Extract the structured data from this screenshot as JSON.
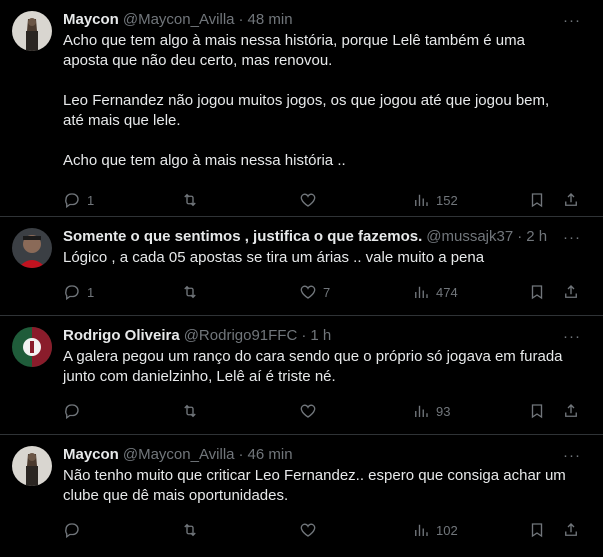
{
  "tweets": [
    {
      "name": "Maycon",
      "handle": "@Maycon_Avilla",
      "time": "48 min",
      "text": "Acho que tem algo à mais nessa história, porque Lelê também é uma\naposta que não deu certo, mas renovou.\n\nLeo Fernandez não jogou muitos jogos, os que jogou até que jogou bem,\naté mais que lele.\n\nAcho que tem algo à mais nessa história ..",
      "replies": "1",
      "retweets": "",
      "likes": "",
      "views": "152"
    },
    {
      "name": "Somente o que sentimos , justifica o que fazemos.",
      "handle": "@mussajk37",
      "time": "2 h",
      "text": "Lógico , a cada 05 apostas se tira um árias .. vale muito a pena",
      "replies": "1",
      "retweets": "",
      "likes": "7",
      "views": "474"
    },
    {
      "name": "Rodrigo Oliveira",
      "handle": "@Rodrigo91FFC",
      "time": "1 h",
      "text": "A galera pegou um ranço do cara sendo que o próprio só jogava em furada\njunto com danielzinho, Lelê aí é triste né.",
      "replies": "",
      "retweets": "",
      "likes": "",
      "views": "93"
    },
    {
      "name": "Maycon",
      "handle": "@Maycon_Avilla",
      "time": "46 min",
      "text": "Não tenho muito que criticar Leo Fernandez.. espero que consiga achar um\nclube que dê mais oportunidades.",
      "replies": "",
      "retweets": "",
      "likes": "",
      "views": "102"
    }
  ],
  "dot": "·",
  "more": "···"
}
